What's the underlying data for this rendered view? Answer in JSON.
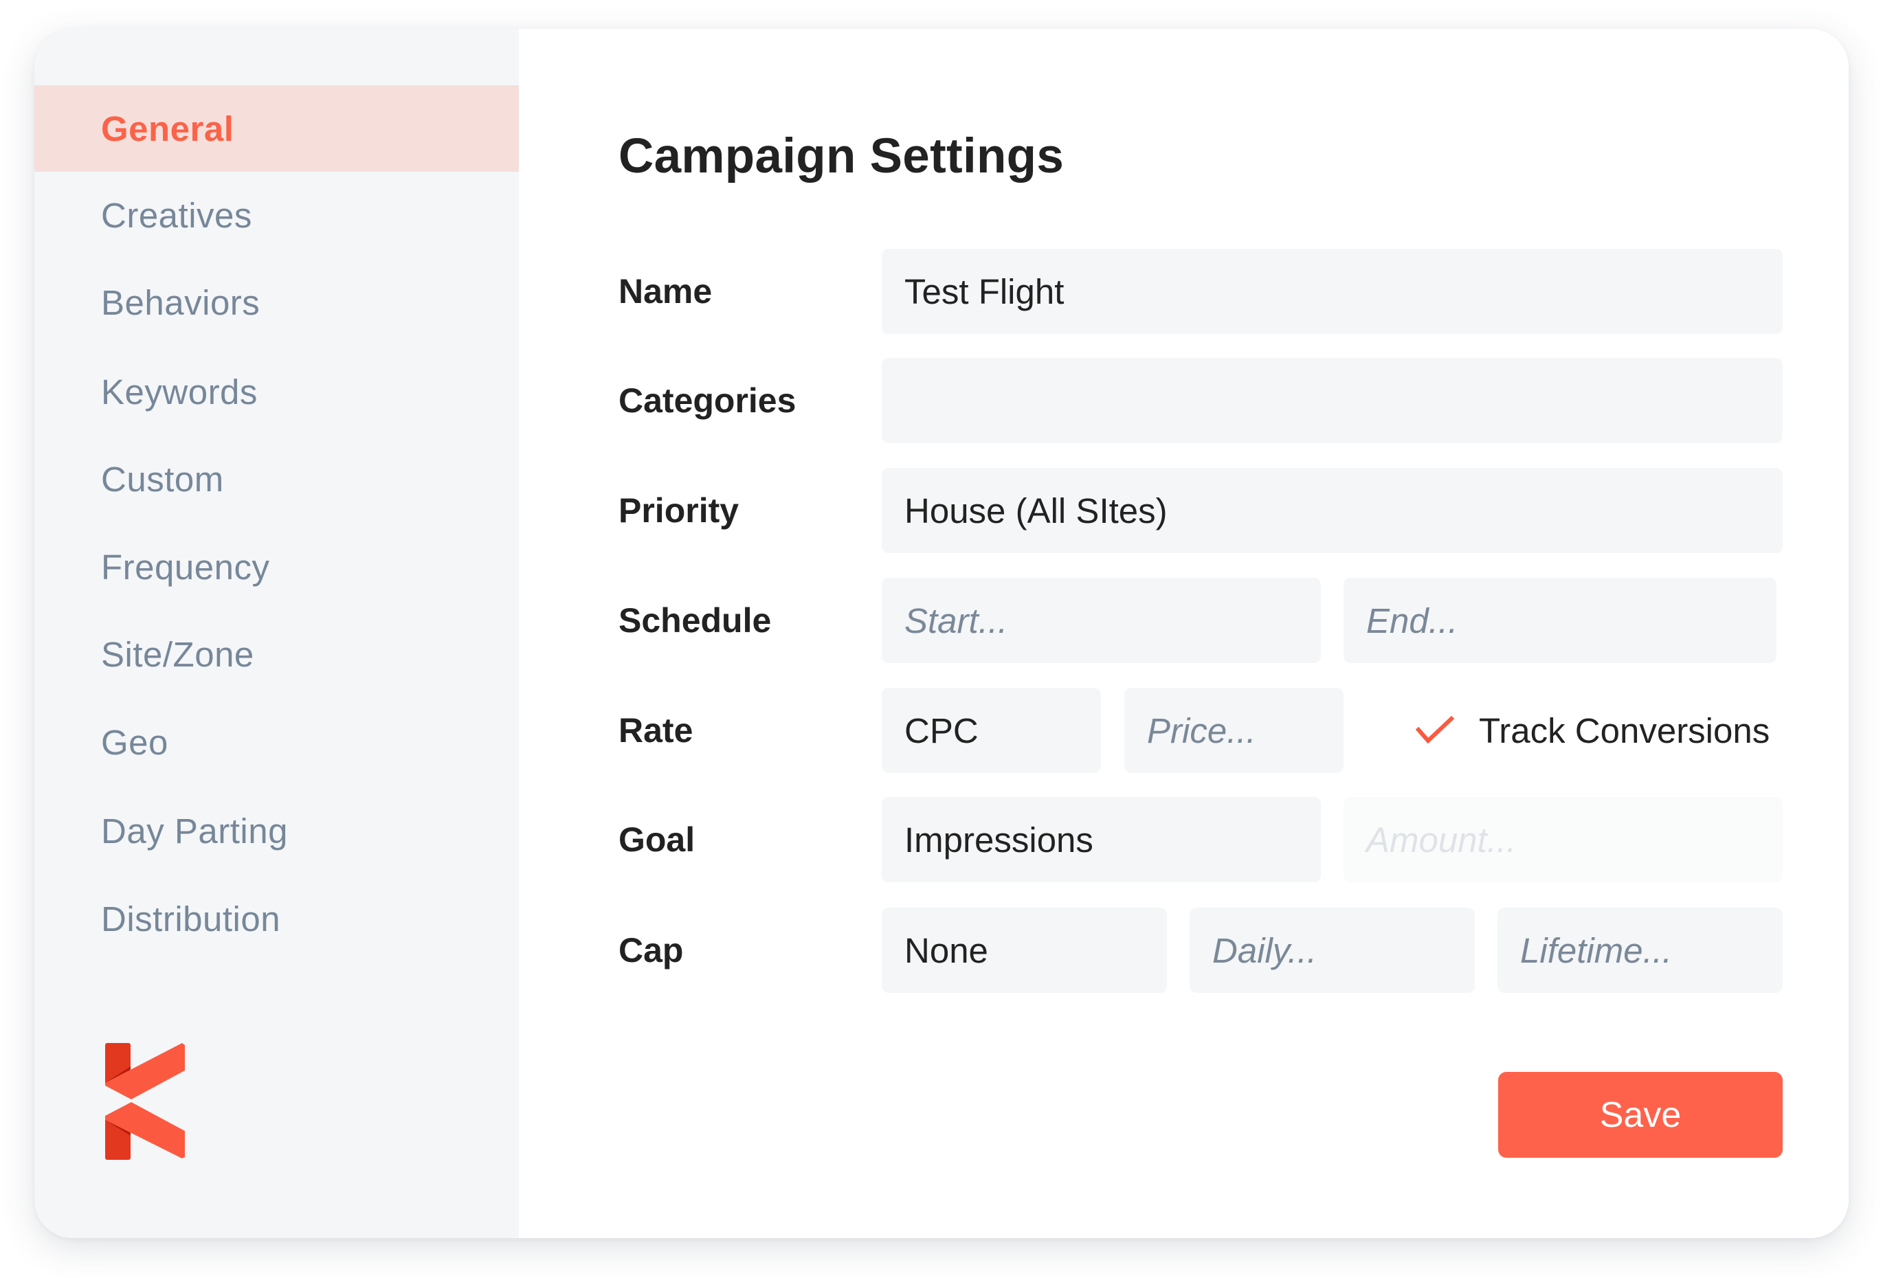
{
  "sidebar": {
    "items": [
      {
        "label": "General",
        "active": true
      },
      {
        "label": "Creatives",
        "active": false
      },
      {
        "label": "Behaviors",
        "active": false
      },
      {
        "label": "Keywords",
        "active": false
      },
      {
        "label": "Custom",
        "active": false
      },
      {
        "label": "Frequency",
        "active": false
      },
      {
        "label": "Site/Zone",
        "active": false
      },
      {
        "label": "Geo",
        "active": false
      },
      {
        "label": "Day Parting",
        "active": false
      },
      {
        "label": "Distribution",
        "active": false
      }
    ],
    "logo": "k-ribbon-logo"
  },
  "main": {
    "title": "Campaign Settings",
    "form": {
      "name": {
        "label": "Name",
        "value": "Test Flight"
      },
      "categories": {
        "label": "Categories",
        "value": ""
      },
      "priority": {
        "label": "Priority",
        "value": "House (All SItes)"
      },
      "schedule": {
        "label": "Schedule",
        "start_placeholder": "Start...",
        "end_placeholder": "End..."
      },
      "rate": {
        "label": "Rate",
        "type_value": "CPC",
        "price_placeholder": "Price...",
        "track_conversions_label": "Track Conversions",
        "track_conversions_checked": true
      },
      "goal": {
        "label": "Goal",
        "type_value": "Impressions",
        "amount_placeholder": "Amount...",
        "amount_disabled": true
      },
      "cap": {
        "label": "Cap",
        "type_value": "None",
        "daily_placeholder": "Daily...",
        "lifetime_placeholder": "Lifetime..."
      }
    },
    "save_label": "Save"
  },
  "colors": {
    "accent": "#fe624a",
    "active_nav_bg": "#f6dfdb",
    "sidebar_bg": "#f4f6f8",
    "nav_text": "#778799",
    "field_bg": "#f4f6f7"
  }
}
